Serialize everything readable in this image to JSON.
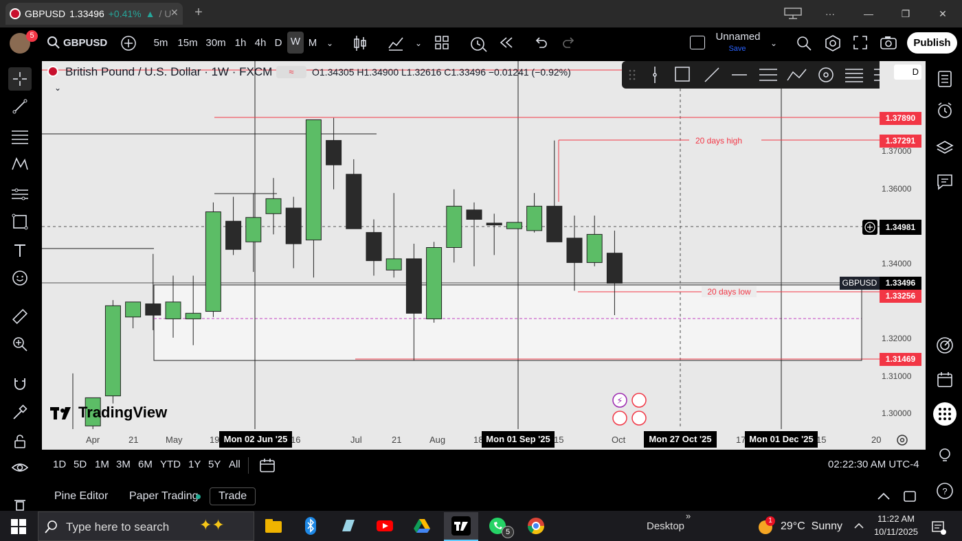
{
  "browser": {
    "tab_title": "GBPUSD",
    "tab_price": "1.33496",
    "tab_change": "+0.41%",
    "tab_suffix": "/ U",
    "close_glyph": "✕",
    "new_tab_glyph": "+",
    "window_controls": [
      "desktop-icon",
      "more-icon",
      "minimize-icon",
      "restore-icon",
      "close-icon"
    ]
  },
  "toolbar": {
    "avatar_badge": "5",
    "symbol": "GBPUSD",
    "intervals": [
      "5m",
      "15m",
      "30m",
      "1h",
      "4h",
      "D",
      "W",
      "M"
    ],
    "selected_interval": "W",
    "layout_name": "Unnamed",
    "layout_sub": "Save",
    "publish_label": "Publish"
  },
  "chart": {
    "legend_title": "British Pound / U.S. Dollar · 1W · FXCM",
    "ohlc": "O1.34305  H1.34900  L1.32616  C1.33496  −0.01241  (−0.92%)",
    "watermark": "TradingView",
    "labels": {
      "high20": "20 days high",
      "low20": "20 days low"
    },
    "price_axis": {
      "ticks": [
        "1.37000",
        "1.36000",
        "1.34000",
        "1.32000",
        "1.31000",
        "1.30000"
      ],
      "badges": {
        "p1": "1.37890",
        "p2": "1.37291",
        "cross": "1.34981",
        "sym": "GBPUSD",
        "last": "1.33496",
        "p3": "1.33256",
        "p4": "1.31469"
      }
    },
    "time_axis": {
      "ticks": [
        "Apr",
        "21",
        "May",
        "19",
        "16",
        "Jul",
        "21",
        "Aug",
        "18",
        "15",
        "Oct",
        "17",
        "15",
        "20"
      ],
      "markers": [
        "Mon 02 Jun '25",
        "Mon 01 Sep '25",
        "Mon 27 Oct '25",
        "Mon 01 Dec '25"
      ]
    }
  },
  "chart_data": {
    "type": "candlestick",
    "title": "British Pound / U.S. Dollar · 1W · FXCM",
    "y_range": [
      1.295,
      1.387
    ],
    "candles": [
      {
        "o": 1.2915,
        "h": 1.311,
        "l": 1.285,
        "c": 1.29
      },
      {
        "o": 1.297,
        "h": 1.304,
        "l": 1.292,
        "c": 1.3045
      },
      {
        "o": 1.305,
        "h": 1.3305,
        "l": 1.303,
        "c": 1.329
      },
      {
        "o": 1.326,
        "h": 1.33,
        "l": 1.323,
        "c": 1.33
      },
      {
        "o": 1.3295,
        "h": 1.3428,
        "l": 1.3225,
        "c": 1.3265
      },
      {
        "o": 1.3255,
        "h": 1.337,
        "l": 1.3205,
        "c": 1.33
      },
      {
        "o": 1.3255,
        "h": 1.337,
        "l": 1.3185,
        "c": 1.327
      },
      {
        "o": 1.3275,
        "h": 1.3565,
        "l": 1.326,
        "c": 1.354
      },
      {
        "o": 1.3515,
        "h": 1.358,
        "l": 1.3425,
        "c": 1.344
      },
      {
        "o": 1.346,
        "h": 1.359,
        "l": 1.338,
        "c": 1.3525
      },
      {
        "o": 1.3535,
        "h": 1.363,
        "l": 1.348,
        "c": 1.3575
      },
      {
        "o": 1.355,
        "h": 1.358,
        "l": 1.339,
        "c": 1.3455
      },
      {
        "o": 1.3465,
        "h": 1.377,
        "l": 1.3365,
        "c": 1.3785
      },
      {
        "o": 1.373,
        "h": 1.379,
        "l": 1.36,
        "c": 1.3665
      },
      {
        "o": 1.364,
        "h": 1.368,
        "l": 1.35,
        "c": 1.3495
      },
      {
        "o": 1.3485,
        "h": 1.352,
        "l": 1.337,
        "c": 1.341
      },
      {
        "o": 1.3385,
        "h": 1.359,
        "l": 1.3365,
        "c": 1.3415
      },
      {
        "o": 1.3415,
        "h": 1.3455,
        "l": 1.3145,
        "c": 1.327
      },
      {
        "o": 1.3255,
        "h": 1.346,
        "l": 1.3245,
        "c": 1.3445
      },
      {
        "o": 1.3445,
        "h": 1.36,
        "l": 1.3405,
        "c": 1.3555
      },
      {
        "o": 1.3545,
        "h": 1.3565,
        "l": 1.3395,
        "c": 1.352
      },
      {
        "o": 1.351,
        "h": 1.3535,
        "l": 1.3425,
        "c": 1.3505
      },
      {
        "o": 1.3495,
        "h": 1.3512,
        "l": 1.3495,
        "c": 1.3512
      },
      {
        "o": 1.349,
        "h": 1.359,
        "l": 1.3485,
        "c": 1.3555
      },
      {
        "o": 1.3555,
        "h": 1.373,
        "l": 1.346,
        "c": 1.346
      },
      {
        "o": 1.347,
        "h": 1.353,
        "l": 1.333,
        "c": 1.3405
      },
      {
        "o": 1.3405,
        "h": 1.353,
        "l": 1.3395,
        "c": 1.348
      },
      {
        "o": 1.343,
        "h": 1.349,
        "l": 1.3265,
        "c": 1.335
      }
    ]
  },
  "bottom": {
    "ranges": [
      "1D",
      "5D",
      "1M",
      "3M",
      "6M",
      "YTD",
      "1Y",
      "5Y",
      "All"
    ],
    "clock": "02:22:30 AM UTC-4",
    "panels": [
      "Pine Editor",
      "Paper Trading",
      "Trade"
    ]
  },
  "taskbar": {
    "search_placeholder": "Type here to search",
    "whatsapp_badge": "5",
    "desktop_label": "Desktop",
    "weather_badge": "1",
    "weather": "29°C  Sunny",
    "time": "11:22 AM",
    "date": "10/11/2025"
  },
  "colors": {
    "up": "#5cbd66",
    "down": "#2a2a2a",
    "red": "#f23645",
    "accent": "#2962ff"
  }
}
